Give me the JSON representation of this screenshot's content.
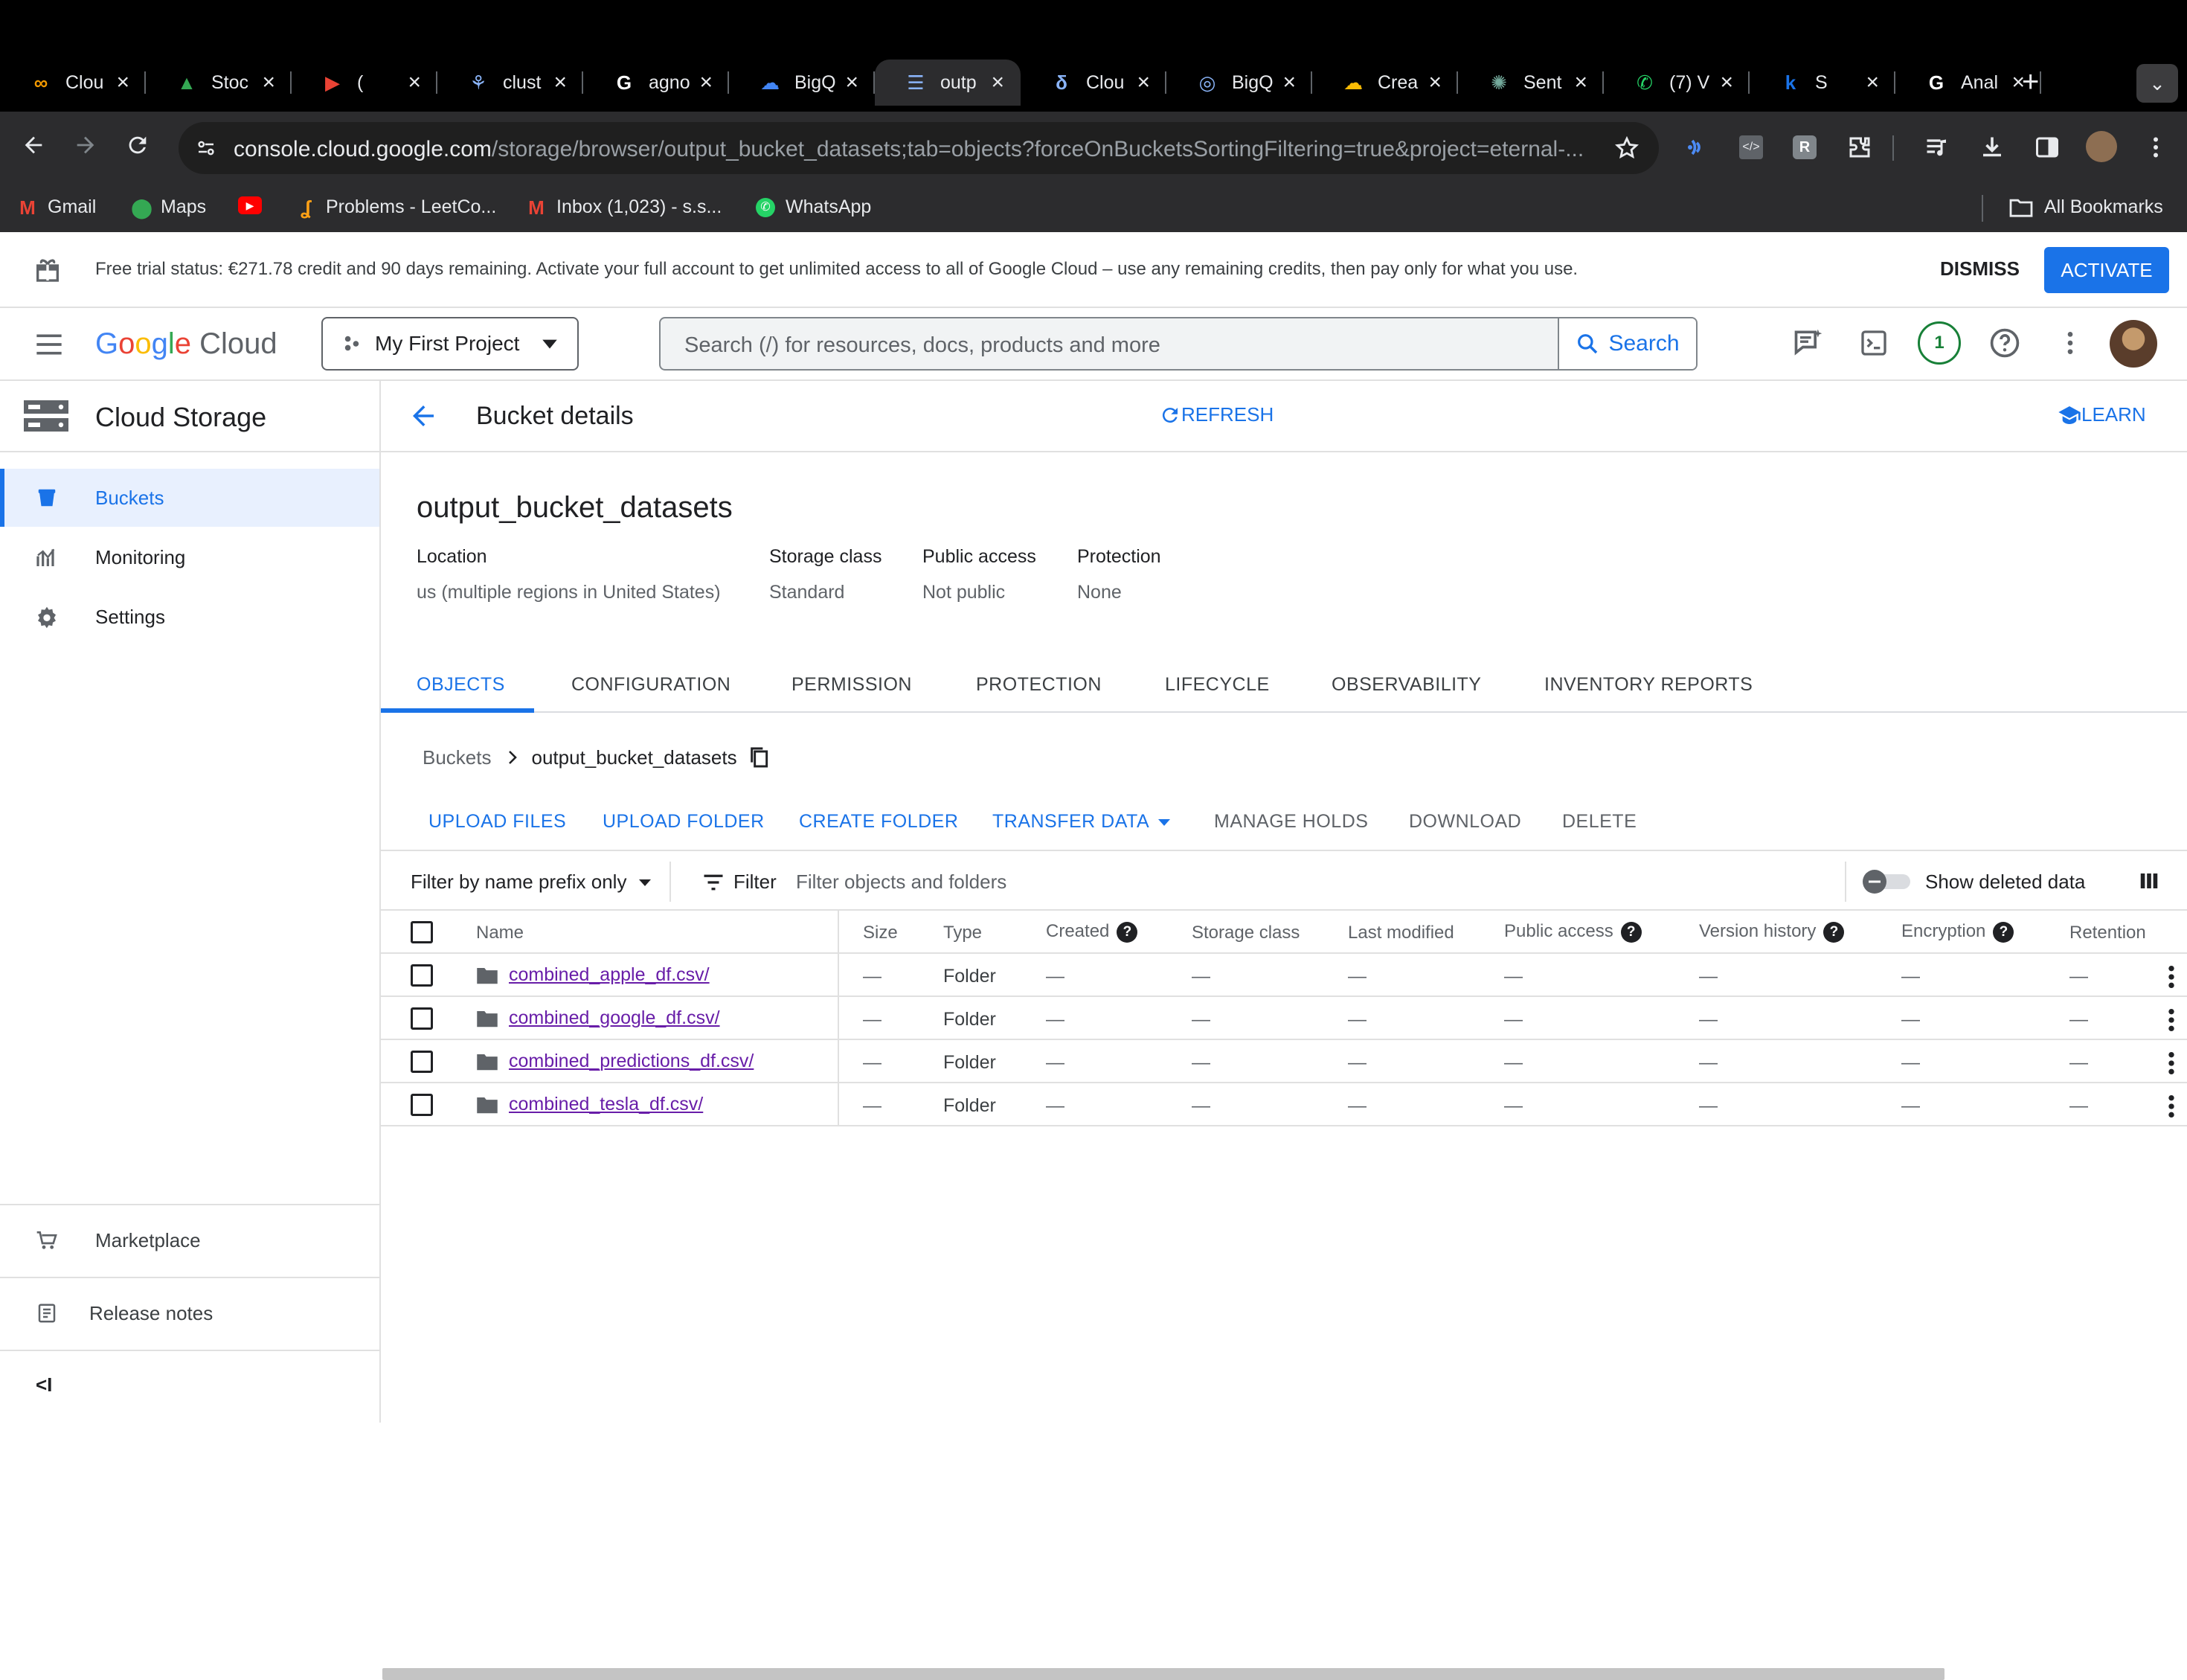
{
  "browser": {
    "tabs": [
      {
        "label": "Clou",
        "color": "#f29900",
        "glyph": "∞",
        "active": false
      },
      {
        "label": "Stoc",
        "color": "#34a853",
        "glyph": "▲",
        "active": false
      },
      {
        "label": "(",
        "color": "#ea4335",
        "glyph": "▶",
        "active": false
      },
      {
        "label": "clust",
        "color": "#8ab4f8",
        "glyph": "⚘",
        "active": false
      },
      {
        "label": "agno",
        "color": "#ffffff",
        "glyph": "G",
        "active": false
      },
      {
        "label": "BigQ",
        "color": "#4285f4",
        "glyph": "☁",
        "active": false
      },
      {
        "label": "outp",
        "color": "#8ab4f8",
        "glyph": "☰",
        "active": true
      },
      {
        "label": "Clou",
        "color": "#8ab4f8",
        "glyph": "δ",
        "active": false
      },
      {
        "label": "BigQ",
        "color": "#8ab4f8",
        "glyph": "◎",
        "active": false
      },
      {
        "label": "Crea",
        "color": "#fbbc04",
        "glyph": "☁",
        "active": false
      },
      {
        "label": "Sent",
        "color": "#74aa9c",
        "glyph": "✺",
        "active": false
      },
      {
        "label": "(7) V",
        "color": "#25d366",
        "glyph": "✆",
        "active": false
      },
      {
        "label": "S",
        "color": "#1a73e8",
        "glyph": "k",
        "active": false
      },
      {
        "label": "Anal",
        "color": "#ffffff",
        "glyph": "G",
        "active": false
      }
    ],
    "url_host": "console.cloud.google.com",
    "url_path": "/storage/browser/output_bucket_datasets;tab=objects?forceOnBucketsSortingFiltering=true&project=eternal-...",
    "bookmarks": [
      {
        "label": "Gmail",
        "color": "#ea4335"
      },
      {
        "label": "Maps",
        "color": "#34a853"
      },
      {
        "label": "",
        "color": "#ff0000"
      },
      {
        "label": "Problems - LeetCo...",
        "color": "#ffa116"
      },
      {
        "label": "Inbox (1,023) - s.s...",
        "color": "#ea4335"
      },
      {
        "label": "WhatsApp",
        "color": "#25d366"
      }
    ],
    "all_bookmarks": "All Bookmarks"
  },
  "banner": {
    "text": "Free trial status: €271.78 credit and 90 days remaining. Activate your full account to get unlimited access to all of Google Cloud – use any remaining credits, then pay only for what you use.",
    "dismiss": "DISMISS",
    "activate": "ACTIVATE"
  },
  "header": {
    "logo_google": "Google",
    "logo_cloud": "Cloud",
    "project": "My First Project",
    "search_placeholder": "Search (/) for resources, docs, products and more",
    "search_button": "Search",
    "notification_count": "1"
  },
  "sidebar": {
    "title": "Cloud Storage",
    "items": [
      {
        "label": "Buckets",
        "icon": "bucket-icon",
        "active": true
      },
      {
        "label": "Monitoring",
        "icon": "chart-icon",
        "active": false
      },
      {
        "label": "Settings",
        "icon": "gear-icon",
        "active": false
      }
    ],
    "footer": [
      {
        "label": "Marketplace",
        "icon": "cart-icon"
      },
      {
        "label": "Release notes",
        "icon": "notes-icon"
      }
    ],
    "collapse": "<I"
  },
  "page": {
    "title": "Bucket details",
    "refresh": "REFRESH",
    "learn": "LEARN",
    "bucket_name": "output_bucket_datasets",
    "meta": [
      {
        "label": "Location",
        "value": "us (multiple regions in United States)"
      },
      {
        "label": "Storage class",
        "value": "Standard"
      },
      {
        "label": "Public access",
        "value": "Not public"
      },
      {
        "label": "Protection",
        "value": "None"
      }
    ],
    "tabs": [
      "OBJECTS",
      "CONFIGURATION",
      "PERMISSION",
      "PROTECTION",
      "LIFECYCLE",
      "OBSERVABILITY",
      "INVENTORY REPORTS"
    ],
    "breadcrumb": {
      "root": "Buckets",
      "current": "output_bucket_datasets"
    },
    "actions": [
      {
        "label": "UPLOAD FILES",
        "enabled": true
      },
      {
        "label": "UPLOAD FOLDER",
        "enabled": true
      },
      {
        "label": "CREATE FOLDER",
        "enabled": true
      },
      {
        "label": "TRANSFER DATA",
        "enabled": true
      },
      {
        "label": "MANAGE HOLDS",
        "enabled": false
      },
      {
        "label": "DOWNLOAD",
        "enabled": false
      },
      {
        "label": "DELETE",
        "enabled": false
      }
    ],
    "filter": {
      "select": "Filter by name prefix only",
      "button": "Filter",
      "placeholder": "Filter objects and folders",
      "show_deleted": "Show deleted data"
    },
    "table": {
      "columns": [
        "Name",
        "Size",
        "Type",
        "Created",
        "Storage class",
        "Last modified",
        "Public access",
        "Version history",
        "Encryption",
        "Retention"
      ],
      "rows": [
        {
          "name": "combined_apple_df.csv/",
          "size": "—",
          "type": "Folder",
          "created": "—",
          "storage_class": "—",
          "last_modified": "—",
          "public_access": "—",
          "version_history": "—",
          "encryption": "—",
          "retention": "—"
        },
        {
          "name": "combined_google_df.csv/",
          "size": "—",
          "type": "Folder",
          "created": "—",
          "storage_class": "—",
          "last_modified": "—",
          "public_access": "—",
          "version_history": "—",
          "encryption": "—",
          "retention": "—"
        },
        {
          "name": "combined_predictions_df.csv/",
          "size": "—",
          "type": "Folder",
          "created": "—",
          "storage_class": "—",
          "last_modified": "—",
          "public_access": "—",
          "version_history": "—",
          "encryption": "—",
          "retention": "—"
        },
        {
          "name": "combined_tesla_df.csv/",
          "size": "—",
          "type": "Folder",
          "created": "—",
          "storage_class": "—",
          "last_modified": "—",
          "public_access": "—",
          "version_history": "—",
          "encryption": "—",
          "retention": "—"
        }
      ]
    }
  },
  "colors": {
    "accent": "#1a73e8",
    "link_visited": "#681da8",
    "chrome_dark": "#2c2c2e"
  }
}
